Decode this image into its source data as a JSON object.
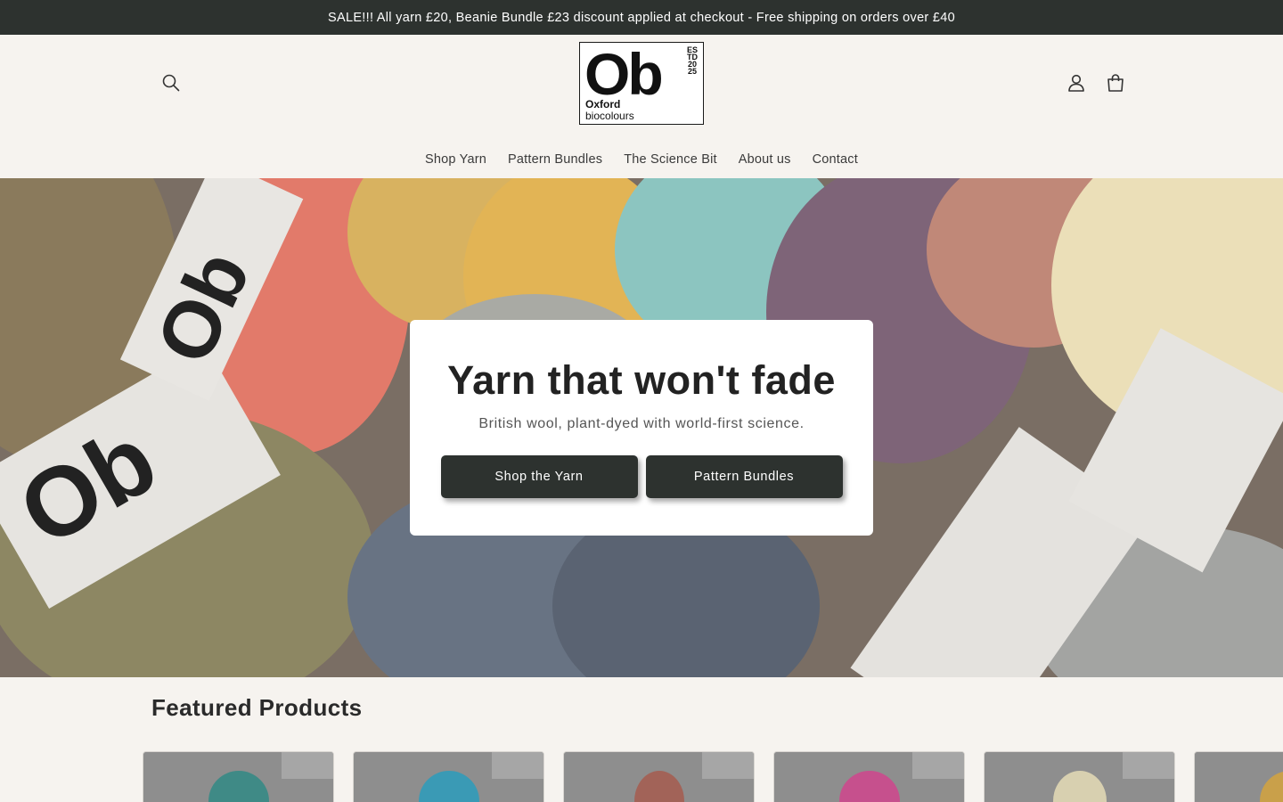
{
  "announcement": "SALE!!! All yarn £20, Beanie Bundle £23 discount applied at checkout - Free shipping on orders over £40",
  "logo": {
    "mark": "Ob",
    "est_lines": [
      "ES",
      "TD",
      "20",
      "25"
    ],
    "name_line1": "Oxford",
    "name_line2": "biocolours"
  },
  "header_icons": {
    "search": "search-icon",
    "account": "user-icon",
    "cart": "bag-icon"
  },
  "nav": {
    "items": [
      "Shop Yarn",
      "Pattern Bundles",
      "The Science Bit",
      "About us",
      "Contact"
    ]
  },
  "hero": {
    "title": "Yarn that won't fade",
    "subtitle": "British wool, plant-dyed with world-first science.",
    "primary_button": "Shop the Yarn",
    "secondary_button": "Pattern Bundles"
  },
  "featured": {
    "title": "Featured Products"
  },
  "products": [
    {
      "yarn_color": "#3f8a86"
    },
    {
      "yarn_color": "#3a9ab5"
    },
    {
      "yarn_color": "#a26358"
    },
    {
      "yarn_color": "#c6508d"
    },
    {
      "yarn_color": "#d8d0b0"
    },
    {
      "yarn_color": "#c9a04a"
    }
  ],
  "colors": {
    "accent": "#2d322f",
    "background": "#f6f3ef"
  }
}
